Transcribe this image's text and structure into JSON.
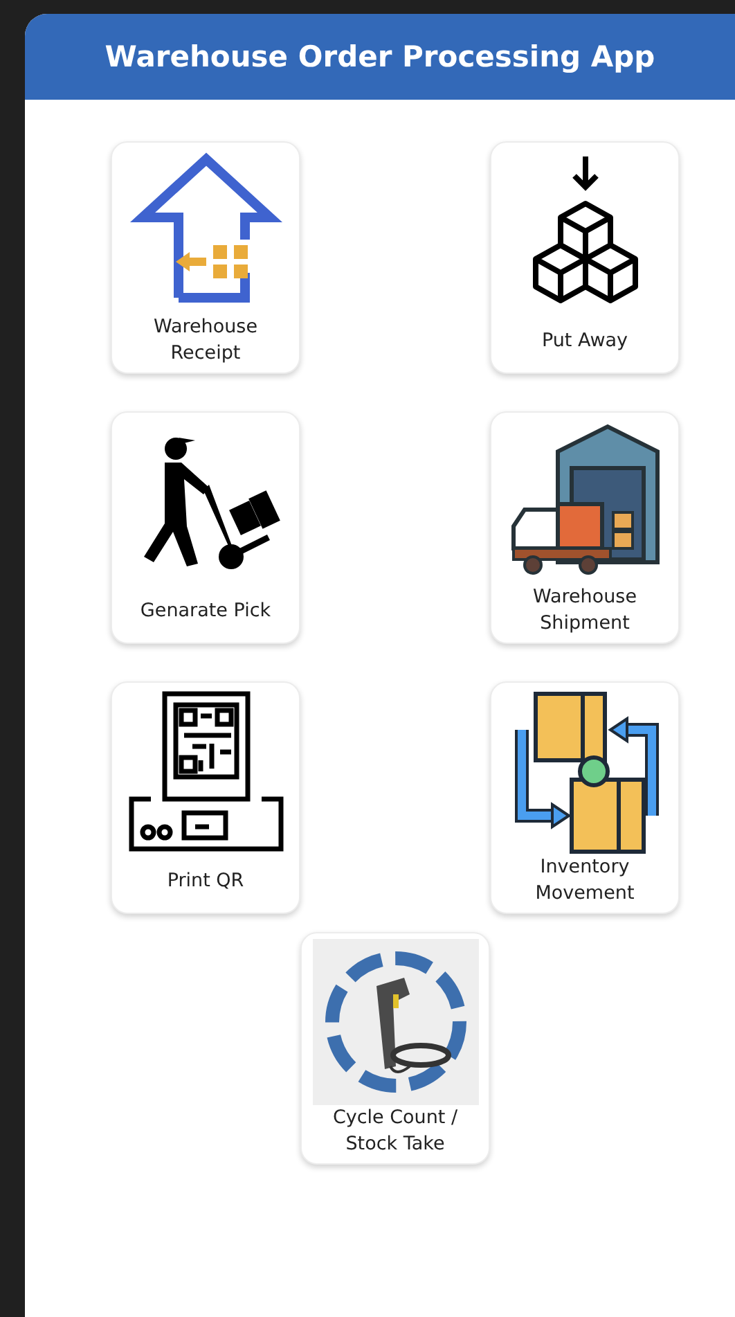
{
  "header": {
    "title": "Warehouse Order Processing App"
  },
  "tiles": [
    {
      "label": "Warehouse Receipt"
    },
    {
      "label": "Put Away"
    },
    {
      "label": "Genarate Pick"
    },
    {
      "label": "Warehouse Shipment"
    },
    {
      "label": "Print QR"
    },
    {
      "label": "Inventory Movement"
    },
    {
      "label": "Cycle Count / Stock Take"
    }
  ]
}
